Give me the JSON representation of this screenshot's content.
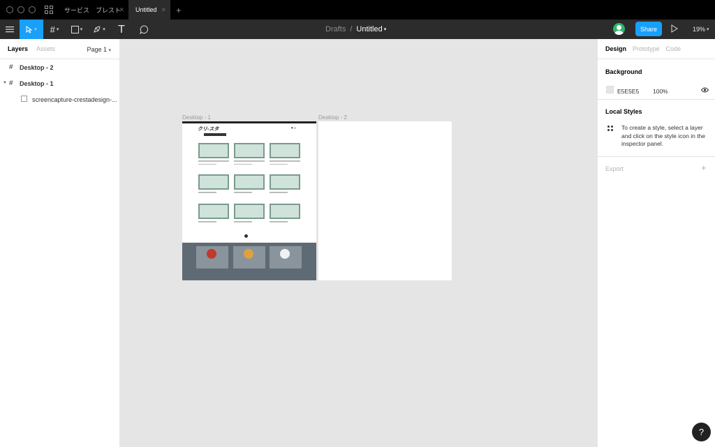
{
  "tabs": [
    {
      "label": "サービス　ブレスト",
      "active": false
    },
    {
      "label": "Untitled",
      "active": true
    }
  ],
  "toolbar": {
    "breadcrumb_parent": "Drafts",
    "breadcrumb_sep": "/",
    "file_name": "Untitled",
    "share_label": "Share",
    "zoom": "19%"
  },
  "layers_panel": {
    "tab_layers": "Layers",
    "tab_assets": "Assets",
    "page_label": "Page 1",
    "layers": [
      {
        "label": "Desktop - 2",
        "type": "frame"
      },
      {
        "label": "Desktop - 1",
        "type": "frame",
        "expanded": true
      },
      {
        "label": "screencapture-crestadesign-...",
        "type": "image"
      }
    ]
  },
  "canvas": {
    "frame1_label": "Desktop - 1",
    "frame2_label": "Desktop - 2",
    "frame1_logo": "クリ-スタ",
    "background_color": "#E5E5E5"
  },
  "design_panel": {
    "tab_design": "Design",
    "tab_prototype": "Prototype",
    "tab_code": "Code",
    "background_title": "Background",
    "background_hex": "E5E5E5",
    "background_opacity": "100%",
    "local_styles_title": "Local Styles",
    "local_styles_text": "To create a style, select a layer and click on the style icon in the inspector panel.",
    "export_title": "Export"
  },
  "help_label": "?",
  "colors": {
    "accent": "#18a0fb",
    "toolbar": "#2c2c2c",
    "canvas": "#e5e5e5"
  }
}
